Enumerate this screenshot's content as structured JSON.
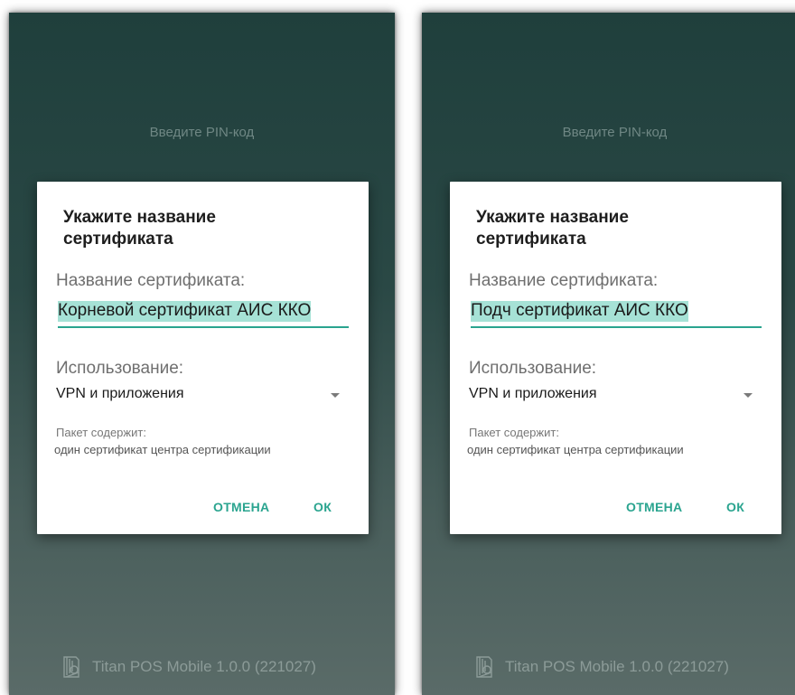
{
  "screens": [
    {
      "pin_prompt": "Введите PIN-код",
      "dialog": {
        "title": "Укажите название сертификата",
        "name_label": "Название сертификата:",
        "name_value": "Корневой сертификат АИС ККО",
        "usage_label": "Использование:",
        "usage_value": "VPN и приложения",
        "package_label": "Пакет содержит:",
        "package_value": "один сертификат центра сертификации",
        "cancel_label": "ОТМЕНА",
        "ok_label": "ОК"
      },
      "footer": {
        "app_name": "Titan POS Mobile 1.0.0 (221027)",
        "logo_icon": "titan-logo-icon"
      }
    },
    {
      "pin_prompt": "Введите PIN-код",
      "dialog": {
        "title": "Укажите название сертификата",
        "name_label": "Название сертификата:",
        "name_value": "Подч сертификат АИС ККО",
        "usage_label": "Использование:",
        "usage_value": "VPN и приложения",
        "package_label": "Пакет содержит:",
        "package_value": "один сертификат центра сертификации",
        "cancel_label": "ОТМЕНА",
        "ok_label": "ОК"
      },
      "footer": {
        "app_name": "Titan POS Mobile 1.0.0 (221027)",
        "logo_icon": "titan-logo-icon"
      }
    }
  ],
  "colors": {
    "accent": "#2aa48f",
    "selection": "#a6e2d6",
    "background_top": "#1f3f3c",
    "background_bottom": "#5a6b68"
  }
}
